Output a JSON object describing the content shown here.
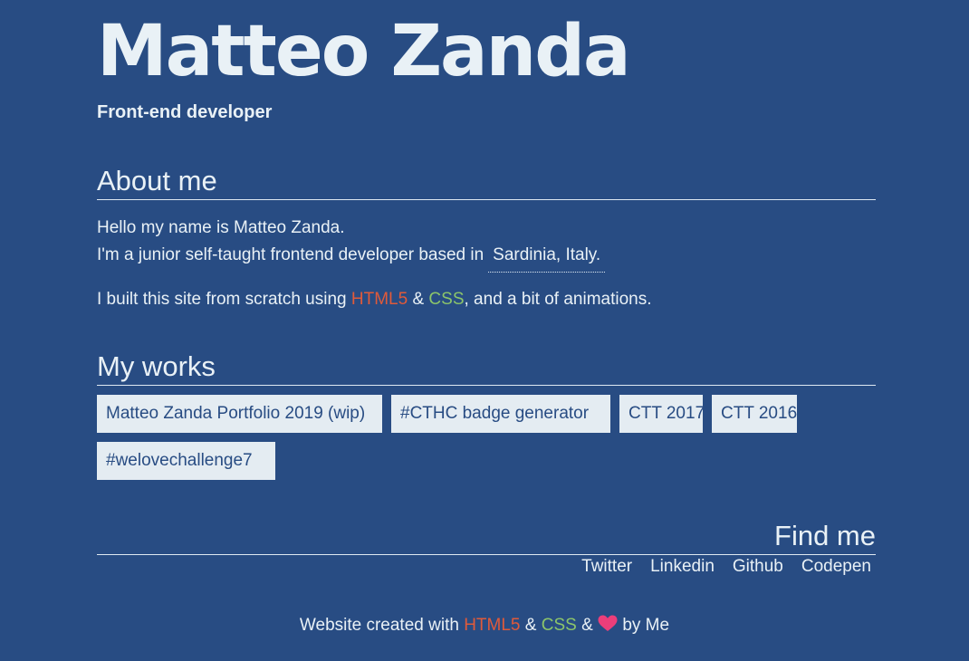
{
  "header": {
    "name": "Matteo Zanda",
    "role": "Front-end developer"
  },
  "about": {
    "title": "About me",
    "line1": "Hello my name is Matteo Zanda.",
    "line2_prefix": "I'm a junior self-taught frontend developer based in",
    "location": "Sardinia, Italy.",
    "line3_prefix": "I built this site from scratch using ",
    "html5": "HTML5",
    "amp": " & ",
    "css": "CSS",
    "line3_suffix": ", and a bit of animations."
  },
  "works": {
    "title": "My works",
    "items": [
      "Matteo Zanda Portfolio 2019 (wip)",
      "#CTHC badge generator",
      "CTT 2017",
      "CTT 2016",
      "#welovechallenge7"
    ]
  },
  "find": {
    "title": "Find me",
    "links": [
      "Twitter",
      "Linkedin",
      "Github",
      "Codepen"
    ]
  },
  "footer": {
    "prefix": "Website created with ",
    "html5": "HTML5",
    "amp1": " & ",
    "css": "CSS",
    "amp2": " & ",
    "suffix": " by Me"
  },
  "colors": {
    "background": "#284c83",
    "text": "#e9f1f6",
    "html5": "#e05a3a",
    "css": "#8cc56a",
    "heart": "#ec3e7a",
    "button_bg": "#e4ecf2"
  },
  "icons": {
    "heart": "heart-icon"
  }
}
